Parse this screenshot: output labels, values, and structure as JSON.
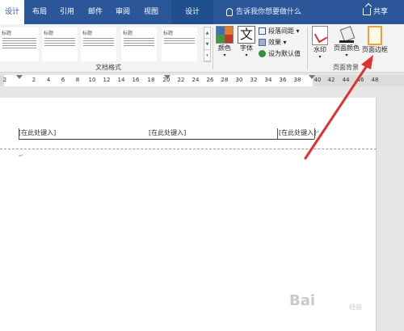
{
  "tabs": [
    {
      "label": "设计",
      "active": true
    },
    {
      "label": "布局"
    },
    {
      "label": "引用"
    },
    {
      "label": "邮件"
    },
    {
      "label": "审阅"
    },
    {
      "label": "视图"
    },
    {
      "label": "设计"
    }
  ],
  "tell_me": "告诉我你想要做什么",
  "share": "共享",
  "styles": [
    {
      "title": "标题"
    },
    {
      "title": "标题"
    },
    {
      "title": "标题"
    },
    {
      "title": "标题"
    },
    {
      "title": "标题"
    },
    {
      "title": "标题"
    }
  ],
  "group_document_format": "文档格式",
  "buttons": {
    "colors": "颜色",
    "fonts": "字体",
    "paragraph_spacing": "段落间距",
    "effects": "效果",
    "set_default": "设为默认值",
    "watermark": "水印",
    "page_color": "页面颜色",
    "page_borders": "页面边框"
  },
  "group_page_background": "页面背景",
  "ruler_ticks": [
    "2",
    "2",
    "4",
    "6",
    "8",
    "10",
    "12",
    "14",
    "16",
    "18",
    "20",
    "22",
    "24",
    "26",
    "28",
    "30",
    "32",
    "34",
    "36",
    "38",
    "40",
    "42",
    "44",
    "46",
    "48"
  ],
  "header": {
    "left": "[在此处键入]",
    "center": "[在此处键入]",
    "right": "[在此处键入]"
  },
  "watermark_text": "Bai",
  "watermark_sub": "经验",
  "colors": {
    "ribbon_blue": "#2b579a",
    "arrow_red": "#e03030"
  }
}
